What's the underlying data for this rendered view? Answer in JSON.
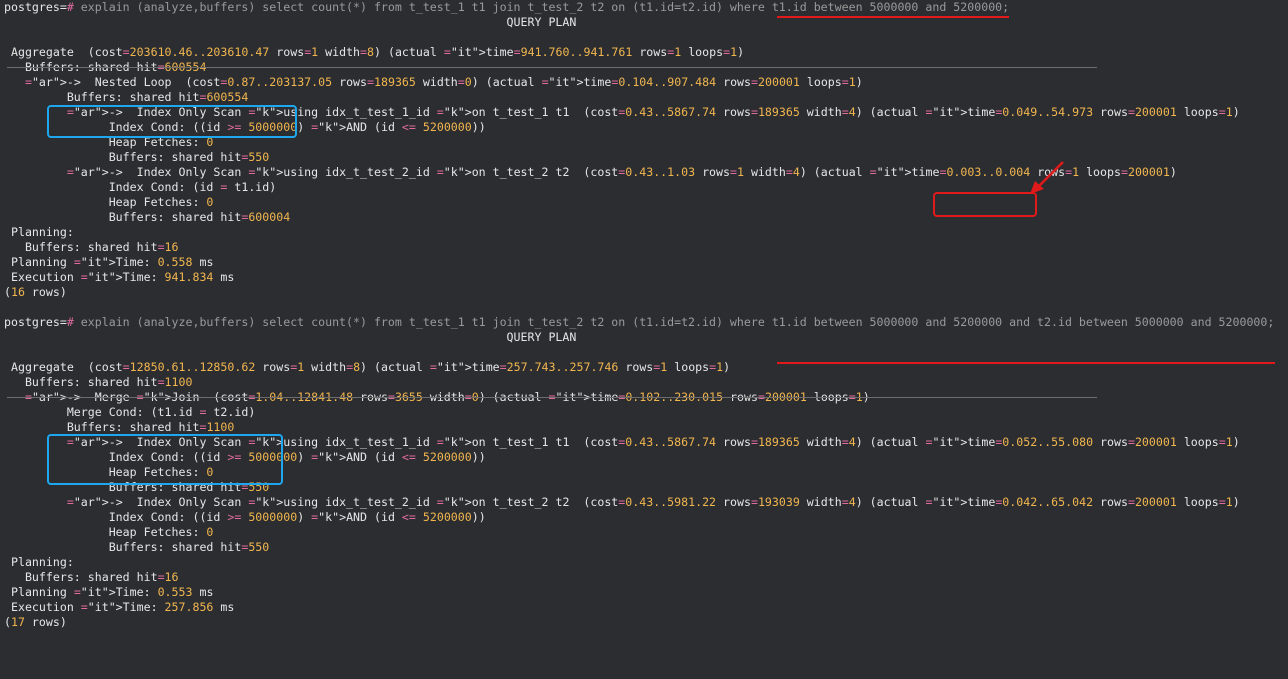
{
  "terminal": {
    "lines": [
      "postgres=# explain (analyze,buffers) select count(*) from t_test_1 t1 join t_test_2 t2 on (t1.id=t2.id) where t1.id between 5000000 and 5200000;",
      "                                                                        QUERY PLAN",
      "",
      " Aggregate  (cost=203610.46..203610.47 rows=1 width=8) (actual time=941.760..941.761 rows=1 loops=1)",
      "   Buffers: shared hit=600554",
      "   ->  Nested Loop  (cost=0.87..203137.05 rows=189365 width=0) (actual time=0.104..907.484 rows=200001 loops=1)",
      "         Buffers: shared hit=600554",
      "         ->  Index Only Scan using idx_t_test_1_id on t_test_1 t1  (cost=0.43..5867.74 rows=189365 width=4) (actual time=0.049..54.973 rows=200001 loops=1)",
      "               Index Cond: ((id >= 5000000) AND (id <= 5200000))",
      "               Heap Fetches: 0",
      "               Buffers: shared hit=550",
      "         ->  Index Only Scan using idx_t_test_2_id on t_test_2 t2  (cost=0.43..1.03 rows=1 width=4) (actual time=0.003..0.004 rows=1 loops=200001)",
      "               Index Cond: (id = t1.id)",
      "               Heap Fetches: 0",
      "               Buffers: shared hit=600004",
      " Planning:",
      "   Buffers: shared hit=16",
      " Planning Time: 0.558 ms",
      " Execution Time: 941.834 ms",
      "(16 rows)",
      "",
      "postgres=# explain (analyze,buffers) select count(*) from t_test_1 t1 join t_test_2 t2 on (t1.id=t2.id) where t1.id between 5000000 and 5200000 and t2.id between 5000000 and 5200000;",
      "                                                                        QUERY PLAN",
      "",
      " Aggregate  (cost=12850.61..12850.62 rows=1 width=8) (actual time=257.743..257.746 rows=1 loops=1)",
      "   Buffers: shared hit=1100",
      "   ->  Merge Join  (cost=1.04..12841.48 rows=3655 width=0) (actual time=0.102..230.015 rows=200001 loops=1)",
      "         Merge Cond: (t1.id = t2.id)",
      "         Buffers: shared hit=1100",
      "         ->  Index Only Scan using idx_t_test_1_id on t_test_1 t1  (cost=0.43..5867.74 rows=189365 width=4) (actual time=0.052..55.080 rows=200001 loops=1)",
      "               Index Cond: ((id >= 5000000) AND (id <= 5200000))",
      "               Heap Fetches: 0",
      "               Buffers: shared hit=550",
      "         ->  Index Only Scan using idx_t_test_2_id on t_test_2 t2  (cost=0.43..5981.22 rows=193039 width=4) (actual time=0.042..65.042 rows=200001 loops=1)",
      "               Index Cond: ((id >= 5000000) AND (id <= 5200000))",
      "               Heap Fetches: 0",
      "               Buffers: shared hit=550",
      " Planning:",
      "   Buffers: shared hit=16",
      " Planning Time: 0.553 ms",
      " Execution Time: 257.856 ms",
      "(17 rows)"
    ]
  },
  "annotations": {
    "underline_color": "#e01a1a",
    "box_blue_color": "#1ea7ef",
    "box_red_color": "#e01a1a"
  },
  "colors": {
    "background": "#2b2d31",
    "text": "#e6e6e6",
    "keyword": "#e06c9f",
    "number": "#f2b64f",
    "arrow": "#f0644a"
  }
}
